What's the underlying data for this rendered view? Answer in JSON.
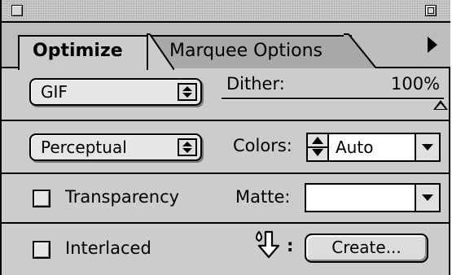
{
  "tabs": [
    {
      "label": "Optimize",
      "active": true
    },
    {
      "label": "Marquee Options",
      "active": false
    }
  ],
  "format": {
    "selected": "GIF"
  },
  "dither": {
    "label": "Dither:",
    "value": "100%",
    "level": 1.0
  },
  "palette_reduction": {
    "selected": "Perceptual"
  },
  "colors": {
    "label": "Colors:",
    "value": "Auto"
  },
  "transparency": {
    "label": "Transparency",
    "checked": false
  },
  "matte": {
    "label": "Matte:",
    "value": ""
  },
  "interlaced": {
    "label": "Interlaced",
    "checked": false
  },
  "droplet": {
    "separator": ":",
    "create_label": "Create..."
  },
  "icons": {
    "close": "close-box-icon",
    "zoom": "zoom-box-icon",
    "menu": "palette-menu-arrow-icon",
    "droplet": "droplet-arrow-icon"
  }
}
